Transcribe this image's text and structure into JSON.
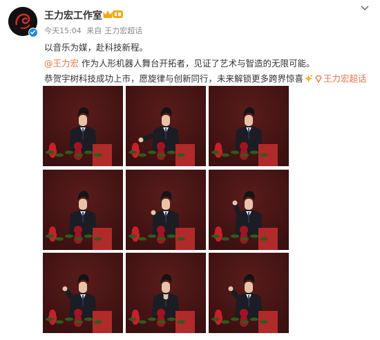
{
  "header": {
    "username": "王力宏工作室",
    "time": "今天15:04",
    "source_prefix": "来自",
    "source": "王力宏超话"
  },
  "post": {
    "line1": "以音乐为媒，赴科技新程。",
    "mention": "@王力宏",
    "line2_rest": " 作为人形机器人舞台开拓者，见证了艺术与智造的无限可能。",
    "line3_text": "恭贺宇树科技成功上市，愿旋律与创新同行，未来解锁更多跨界惊喜",
    "topic_link": "王力宏超话"
  },
  "colors": {
    "link": "#eb7340",
    "verified": "#1e88e5",
    "photo_bg": "#3a1010",
    "podium": "#b02a2a",
    "flowers": "#c8202a"
  },
  "icons": [
    "avatar-logo",
    "verified-icon",
    "vip-crown-badge",
    "more-chevron-icon",
    "diamond-topic-icon",
    "emoji-sparkle-icon"
  ],
  "photos": [
    {
      "pose": "neutral"
    },
    {
      "pose": "arm-out"
    },
    {
      "pose": "neutral"
    },
    {
      "pose": "neutral"
    },
    {
      "pose": "hand-up"
    },
    {
      "pose": "wave"
    },
    {
      "pose": "hand-raised"
    },
    {
      "pose": "hand-chest"
    },
    {
      "pose": "hand-raised"
    }
  ]
}
